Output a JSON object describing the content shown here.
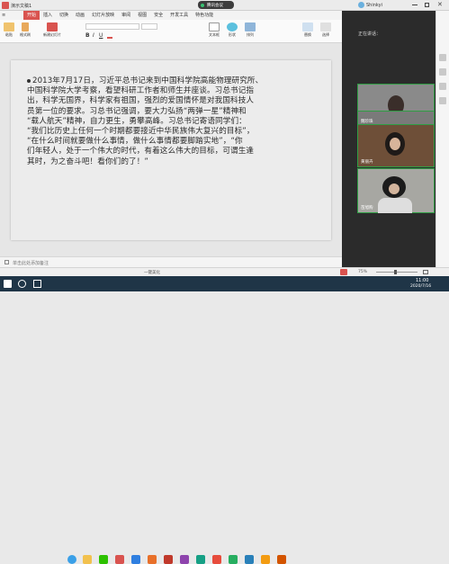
{
  "window": {
    "app_title": "演示文稿1",
    "record_label": "腾讯会议",
    "user": "Shinkyi"
  },
  "ribbon": {
    "tabs": [
      "开始",
      "插入",
      "切换",
      "动画",
      "幻灯片放映",
      "审阅",
      "视图",
      "安全",
      "开发工具",
      "特色功能"
    ],
    "active_tab": "开始",
    "buttons": [
      "粘贴",
      "格式刷",
      "新建幻灯片",
      "版式",
      "重置",
      "文本框",
      "形状",
      "排列",
      "替换",
      "选择"
    ]
  },
  "slide": {
    "lines": [
      "2013年7月17日，习近平总书记来到中国科学院高能物理研究所、",
      "中国科学院大学考察，看望科研工作者和师生并座谈。习总书记指",
      "出，科学无国界，科学家有祖国，强烈的爱国情怀是对我国科技人",
      "员第一位的要求。习总书记强调，要大力弘扬“两弹一星”精神和",
      "“载人航天”精神，自力更生，勇攀高峰。习总书记寄语同学们：",
      "“我们比历史上任何一个时期都要接近中华民族伟大复兴的目标”，",
      "“在什么时间就要做什么事情，做什么事情都要脚踏实地”，“你",
      "们年轻人，处于一个伟大的时代，有着这么伟大的目标，可谓生逢",
      "其时，为之奋斗吧！看你们的了！”"
    ]
  },
  "notes": {
    "placeholder": "单击此处添加备注"
  },
  "meeting": {
    "header": "正在讲话：",
    "participants": [
      "吕丽泽 Antonia",
      "魏珍珠",
      "黄丽卉",
      "苗旭购"
    ]
  },
  "statusbar": {
    "theme": "一键美化",
    "zoom": "75%"
  },
  "taskbar": {
    "time": "11:00",
    "date": "2020/7/16"
  }
}
